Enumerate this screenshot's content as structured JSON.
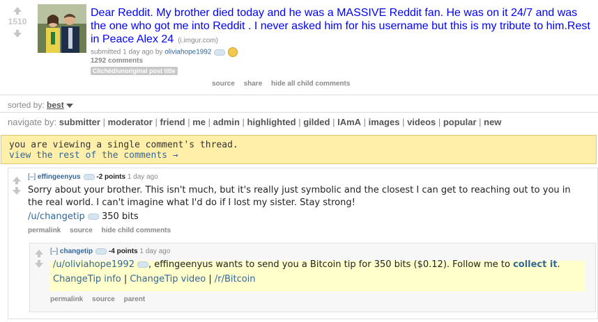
{
  "post": {
    "score": "1510",
    "title": "Dear Reddit. My brother died today and he was a MASSIVE Reddit fan. He was on it 24/7 and was the one who got me into Reddit . I never asked him for his username but this is my tribute to him.Rest in Peace Alex 24",
    "domain": "(i.imgur.com)",
    "submitted_prefix": "submitted 1 day ago by",
    "author": "oliviahope1992",
    "comments": "1292 comments",
    "flair": "Clichéd/unoriginal post title",
    "buttons": [
      "source",
      "share",
      "hide all child comments"
    ]
  },
  "sort": {
    "label": "sorted by:",
    "value": "best"
  },
  "navigate": {
    "label": "navigate by:",
    "items": [
      "submitter",
      "moderator",
      "friend",
      "me",
      "admin",
      "highlighted",
      "gilded",
      "IAmA",
      "images",
      "videos",
      "popular",
      "new"
    ]
  },
  "notice": {
    "line1": "you are viewing a single comment's thread.",
    "line2": "view the rest of the comments →"
  },
  "comment1": {
    "toggle": "[–]",
    "author": "effingeenyus",
    "points": "-2 points",
    "time": "1 day ago",
    "body": "Sorry about your brother. This isn't much, but it's really just symbolic and the closest I can get to reaching out to you in the real world. I can't imagine what I'd do if I lost my sister. Stay strong!",
    "tip_link": "/u/changetip",
    "tip_amount": "350 bits",
    "buttons": [
      "permalink",
      "source",
      "hide child comments"
    ]
  },
  "comment2": {
    "toggle": "[–]",
    "author": "changetip",
    "points": "-4 points",
    "time": "1 day ago",
    "user_link": "/u/oliviahope1992",
    "body_text": ", effingeenyus wants to send you a Bitcoin tip for 350 bits ($0.12). Follow me to",
    "collect_link": "collect it",
    "period": ".",
    "links": [
      "ChangeTip info",
      "ChangeTip video",
      "/r/Bitcoin"
    ],
    "buttons": [
      "permalink",
      "source",
      "parent"
    ]
  }
}
